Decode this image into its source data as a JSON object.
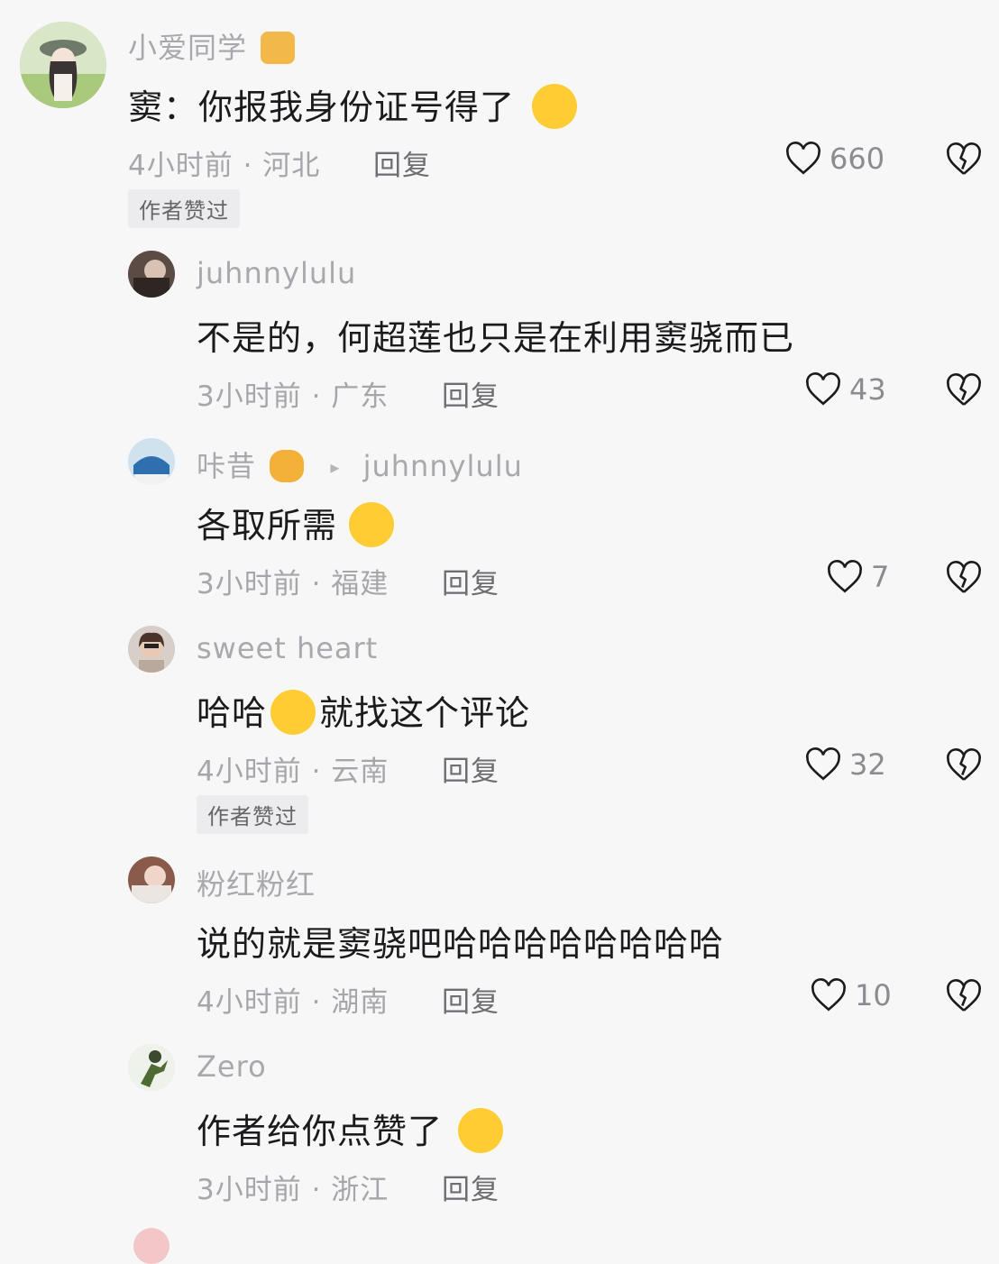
{
  "comments": [
    {
      "username": "小爱同学",
      "text": "窦：你报我身份证号得了",
      "time_location": "4小时前 · 河北",
      "reply": "回复",
      "likes": "660",
      "author_liked": "作者赞过"
    },
    {
      "username": "juhnnylulu",
      "text": "不是的，何超莲也只是在利用窦骁而已",
      "time_location": "3小时前 · 广东",
      "reply": "回复",
      "likes": "43"
    },
    {
      "username": "咔昔",
      "reply_to": "juhnnylulu",
      "text": "各取所需",
      "time_location": "3小时前 · 福建",
      "reply": "回复",
      "likes": "7"
    },
    {
      "username": "sweet heart",
      "text_before": "哈哈",
      "text_after": "就找这个评论",
      "time_location": "4小时前 · 云南",
      "reply": "回复",
      "likes": "32",
      "author_liked": "作者赞过"
    },
    {
      "username": "粉红粉红",
      "text": "说的就是窦骁吧哈哈哈哈哈哈哈哈",
      "time_location": "4小时前 · 湖南",
      "reply": "回复",
      "likes": "10"
    },
    {
      "username": "Zero",
      "text": "作者给你点赞了",
      "time_location": "3小时前 · 浙江",
      "reply": "回复"
    }
  ]
}
